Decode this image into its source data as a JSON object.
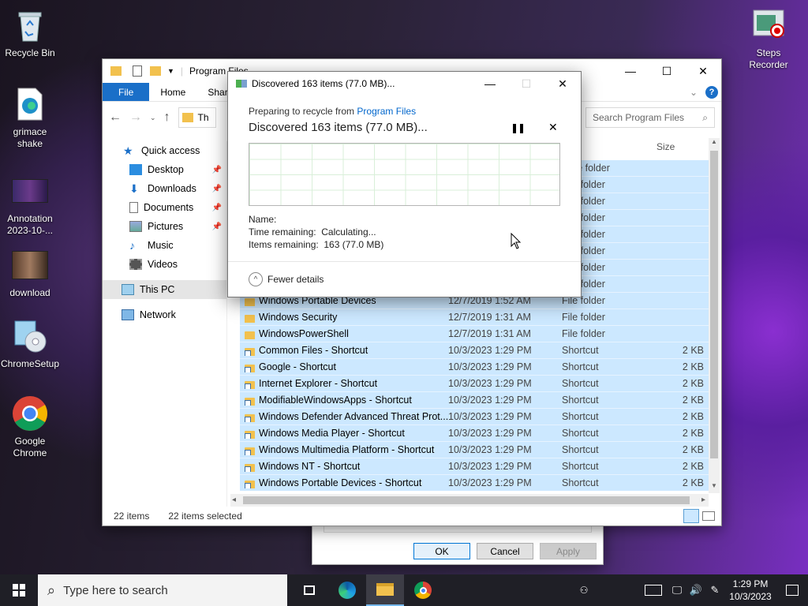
{
  "desktop": {
    "icons": [
      {
        "label": "Recycle Bin"
      },
      {
        "label": "grimace shake"
      },
      {
        "label": "Annotation 2023-10-..."
      },
      {
        "label": "download"
      },
      {
        "label": "ChromeSetup"
      },
      {
        "label": "Google Chrome"
      },
      {
        "label": "Steps Recorder"
      }
    ]
  },
  "explorer": {
    "title": "Program Files",
    "tabs": [
      "File",
      "Home",
      "Share"
    ],
    "address_fragment": "Th",
    "search_placeholder": "Search Program Files",
    "size_header": "Size",
    "nav": {
      "quick_access": "Quick access",
      "desktop": "Desktop",
      "downloads": "Downloads",
      "documents": "Documents",
      "pictures": "Pictures",
      "music": "Music",
      "videos": "Videos",
      "this_pc": "This PC",
      "network": "Network"
    },
    "top_rows_type": "File folder",
    "rows": [
      {
        "name": "Windows Portable Devices",
        "date": "12/7/2019 1:52 AM",
        "type": "File folder",
        "size": "",
        "shortcut": false
      },
      {
        "name": "Windows Security",
        "date": "12/7/2019 1:31 AM",
        "type": "File folder",
        "size": "",
        "shortcut": false
      },
      {
        "name": "WindowsPowerShell",
        "date": "12/7/2019 1:31 AM",
        "type": "File folder",
        "size": "",
        "shortcut": false
      },
      {
        "name": "Common Files - Shortcut",
        "date": "10/3/2023 1:29 PM",
        "type": "Shortcut",
        "size": "2 KB",
        "shortcut": true
      },
      {
        "name": "Google - Shortcut",
        "date": "10/3/2023 1:29 PM",
        "type": "Shortcut",
        "size": "2 KB",
        "shortcut": true
      },
      {
        "name": "Internet Explorer - Shortcut",
        "date": "10/3/2023 1:29 PM",
        "type": "Shortcut",
        "size": "2 KB",
        "shortcut": true
      },
      {
        "name": "ModifiableWindowsApps - Shortcut",
        "date": "10/3/2023 1:29 PM",
        "type": "Shortcut",
        "size": "2 KB",
        "shortcut": true
      },
      {
        "name": "Windows Defender Advanced Threat Prot...",
        "date": "10/3/2023 1:29 PM",
        "type": "Shortcut",
        "size": "2 KB",
        "shortcut": true
      },
      {
        "name": "Windows Media Player - Shortcut",
        "date": "10/3/2023 1:29 PM",
        "type": "Shortcut",
        "size": "2 KB",
        "shortcut": true
      },
      {
        "name": "Windows Multimedia Platform - Shortcut",
        "date": "10/3/2023 1:29 PM",
        "type": "Shortcut",
        "size": "2 KB",
        "shortcut": true
      },
      {
        "name": "Windows NT - Shortcut",
        "date": "10/3/2023 1:29 PM",
        "type": "Shortcut",
        "size": "2 KB",
        "shortcut": true
      },
      {
        "name": "Windows Portable Devices - Shortcut",
        "date": "10/3/2023 1:29 PM",
        "type": "Shortcut",
        "size": "2 KB",
        "shortcut": true
      }
    ],
    "status_items": "22 items",
    "status_selected": "22 items selected"
  },
  "dialog": {
    "title": "Discovered 163 items (77.0 MB)...",
    "prep_prefix": "Preparing to recycle from ",
    "prep_link": "Program Files",
    "heading": "Discovered 163 items (77.0 MB)...",
    "name_label": "Name:",
    "time_label": "Time remaining:",
    "time_value": "Calculating...",
    "items_label": "Items remaining:",
    "items_value": "163 (77.0 MB)",
    "fewer_details": "Fewer details"
  },
  "behind_dialog": {
    "ok": "OK",
    "cancel": "Cancel",
    "apply": "Apply"
  },
  "taskbar": {
    "search_placeholder": "Type here to search",
    "time": "1:29 PM",
    "date": "10/3/2023"
  },
  "colors": {
    "accent": "#1a6fc8",
    "selection": "#cce8ff",
    "link": "#0066cc"
  }
}
